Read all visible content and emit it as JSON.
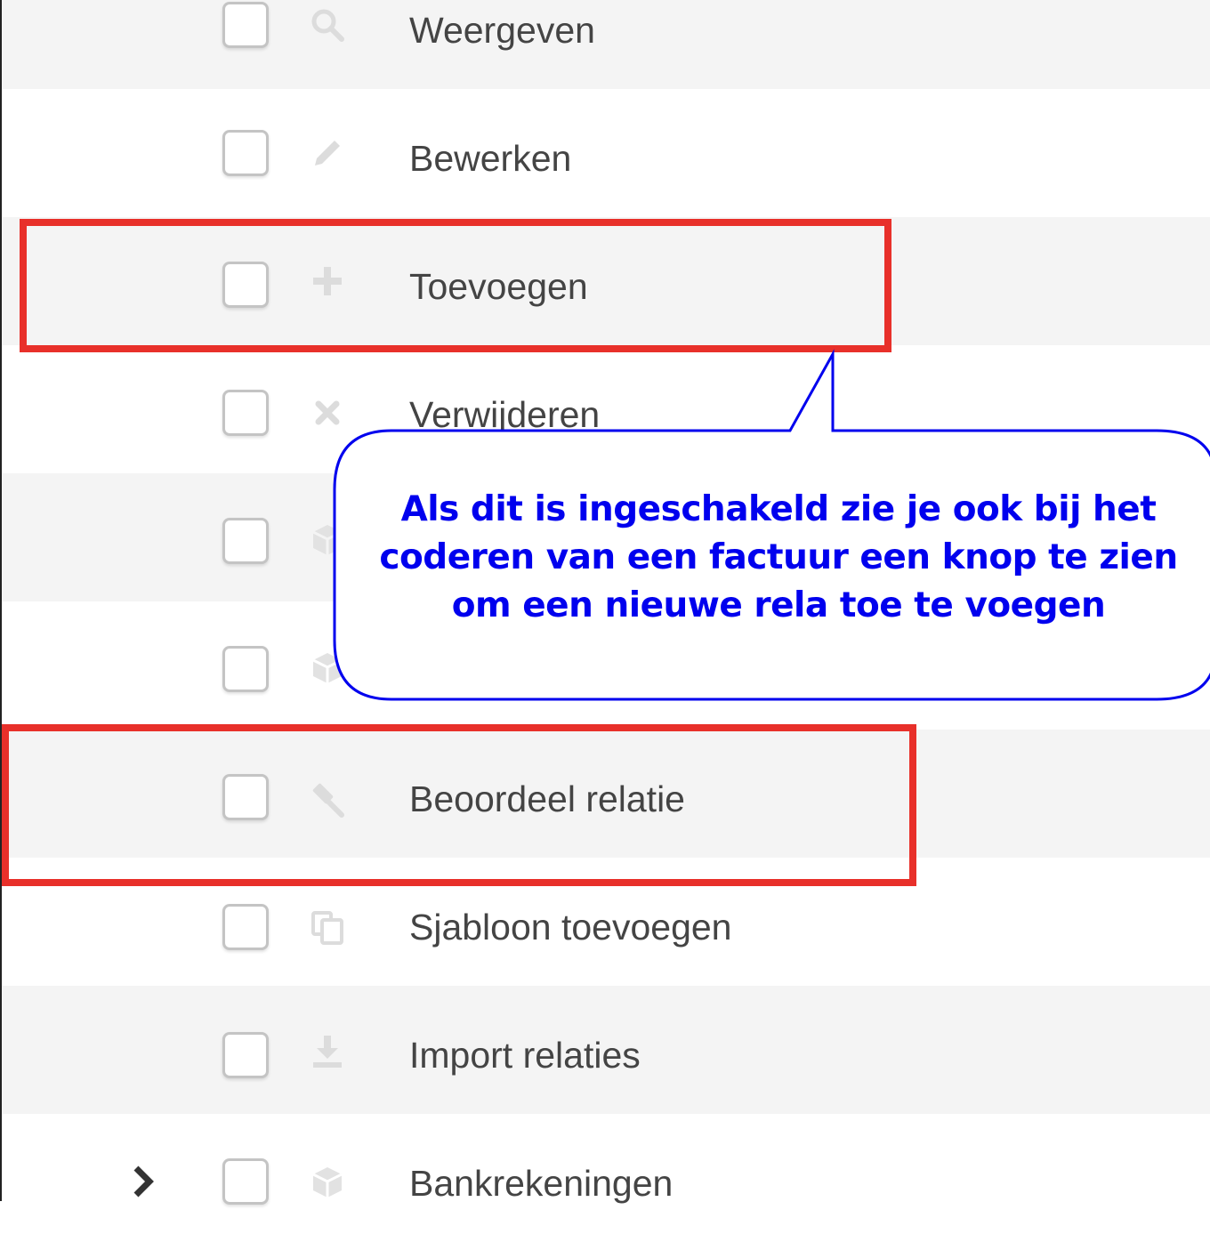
{
  "permissions": [
    {
      "label": "Weergeven",
      "icon": "search-icon",
      "checked": false
    },
    {
      "label": "Bewerken",
      "icon": "pencil-icon",
      "checked": false
    },
    {
      "label": "Toevoegen",
      "icon": "plus-icon",
      "checked": false
    },
    {
      "label": "Verwijderen",
      "icon": "x-icon",
      "checked": false
    },
    {
      "label": "",
      "icon": "cube-icon",
      "checked": false
    },
    {
      "label": "",
      "icon": "cube-icon",
      "checked": false
    },
    {
      "label": "Beoordeel relatie",
      "icon": "gavel-icon",
      "checked": false
    },
    {
      "label": "Sjabloon toevoegen",
      "icon": "copy-icon",
      "checked": false
    },
    {
      "label": "Import relaties",
      "icon": "download-icon",
      "checked": false
    },
    {
      "label": "Bankrekeningen",
      "icon": "cube-icon",
      "checked": false,
      "expandable": true,
      "expander_icon": "chevron-right-icon"
    }
  ],
  "callout": {
    "lines": [
      "Als dit is ingeschakeld zie je ook bij het",
      "coderen van een factuur een knop te zien",
      "om een nieuwe rela toe te voegen"
    ]
  },
  "colors": {
    "highlight": "#e8302a",
    "callout_border": "#0000ee",
    "callout_text": "#0000ee",
    "row_shaded": "#f4f4f4",
    "label": "#444444"
  }
}
